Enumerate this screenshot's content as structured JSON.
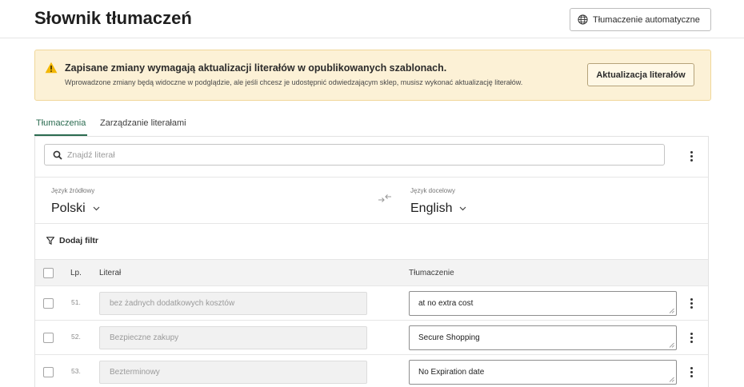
{
  "header": {
    "title": "Słownik tłumaczeń",
    "auto_translate_button": "Tłumaczenie automatyczne",
    "auto_translate_icon": "globe-icon"
  },
  "banner": {
    "icon": "warning-icon",
    "accent_color": "#f2b705",
    "title": "Zapisane zmiany wymagają aktualizacji literałów w opublikowanych szablonach.",
    "description": "Wprowadzone zmiany będą widoczne w podglądzie, ale jeśli chcesz je udostępnić odwiedzającym sklep, musisz wykonać aktualizację literałów.",
    "button": "Aktualizacja literałów"
  },
  "tabs": [
    {
      "label": "Tłumaczenia",
      "active": true
    },
    {
      "label": "Zarządzanie literałami",
      "active": false
    }
  ],
  "search": {
    "placeholder": "Znajdź literał",
    "icon": "search-icon"
  },
  "language": {
    "source_label": "Język źródłowy",
    "source_value": "Polski",
    "target_label": "Język docelowy",
    "target_value": "English",
    "swap_icon": "swap-arrows-icon"
  },
  "filter": {
    "label": "Dodaj filtr",
    "icon": "filter-icon"
  },
  "table": {
    "columns": {
      "lp": "Lp.",
      "literal": "Literał",
      "translation": "Tłumaczenie"
    },
    "rows": [
      {
        "lp": "51.",
        "literal": "bez żadnych dodatkowych kosztów",
        "translation": "at no extra cost"
      },
      {
        "lp": "52.",
        "literal": "Bezpieczne zakupy",
        "translation": "Secure Shopping"
      },
      {
        "lp": "53.",
        "literal": "Bezterminowy",
        "translation": "No Expiration date"
      }
    ]
  },
  "colors": {
    "active_tab": "#2b6b50",
    "banner_bg": "#fcf1d6"
  }
}
